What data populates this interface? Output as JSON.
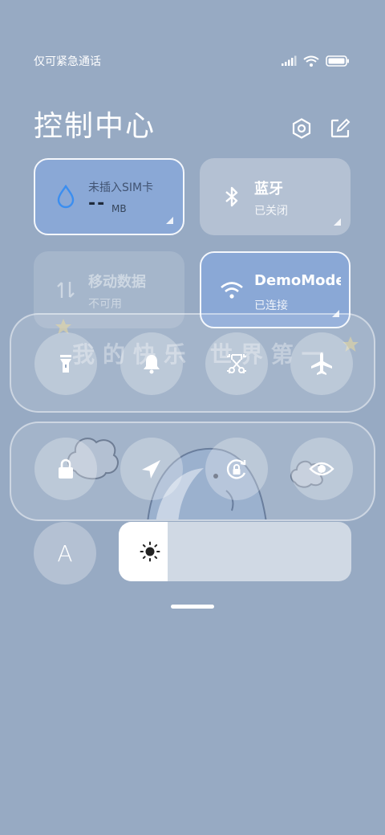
{
  "status": {
    "carrier": "仅可紧急通话"
  },
  "header": {
    "title": "控制中心"
  },
  "tiles": {
    "data_usage": {
      "main": "未插入SIM卡",
      "value": "--",
      "unit": "MB"
    },
    "bluetooth": {
      "label": "蓝牙",
      "status": "已关闭"
    },
    "mobile_data": {
      "label": "移动数据",
      "status": "不可用"
    },
    "wifi": {
      "label": "DemoMode",
      "status": "已连接"
    }
  },
  "toggles_row1": [
    {
      "icon": "flashlight-icon"
    },
    {
      "icon": "bell-icon"
    },
    {
      "icon": "screenshot-icon"
    },
    {
      "icon": "airplane-icon"
    }
  ],
  "toggles_row2": [
    {
      "icon": "lock-icon"
    },
    {
      "icon": "location-icon"
    },
    {
      "icon": "rotation-lock-icon"
    },
    {
      "icon": "eye-icon"
    }
  ],
  "wallpaper_text": "我的快乐 世界第一",
  "auto_brightness_label": "A",
  "brightness": {
    "level": 0.21
  },
  "colors": {
    "background": "#97aac3",
    "active_tile": "#8aa8d6",
    "accent_blue": "#3b8ef0"
  }
}
